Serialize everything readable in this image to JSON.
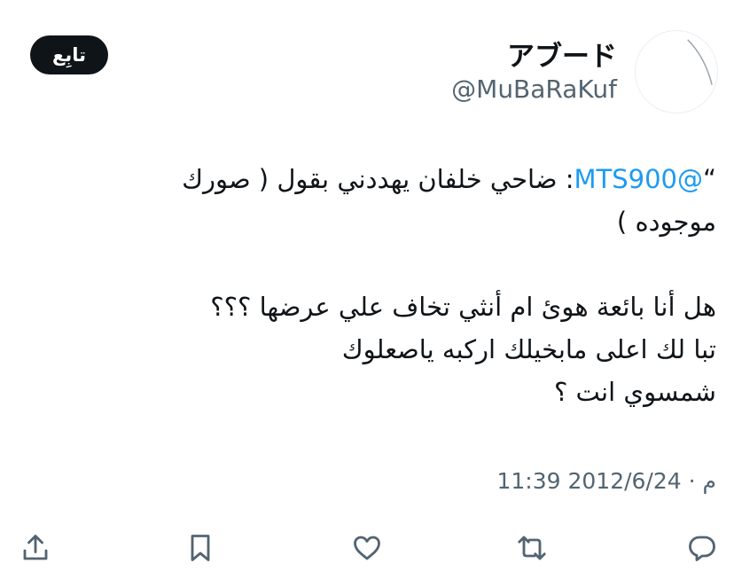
{
  "follow_label": "تابِع",
  "author": {
    "display_name": "アブード",
    "handle": "@MuBaRaKuf",
    "avatar": "blank-avatar"
  },
  "tweet": {
    "quote_open": "“",
    "mention": "@MTS900",
    "line1_rest": ": ضاحي خلفان يهددني بقول ( صورك موجوده )",
    "line2": "هل أنا بائعة هوىٔ ام أنثي تخاف علي عرضها ؟؟؟",
    "line3": "تبا لك اعلى مابخيلك اركبه ياصعلوك",
    "line4": "شمسوي انت ؟",
    "timestamp": "11:39 م · 2012/6/24"
  },
  "colors": {
    "accent": "#1d9bf0",
    "text": "#0f1419",
    "secondary": "#536471",
    "button_bg": "#0f1419"
  },
  "actions": [
    {
      "name": "reply",
      "icon": "reply-icon"
    },
    {
      "name": "retweet",
      "icon": "retweet-icon"
    },
    {
      "name": "like",
      "icon": "heart-icon"
    },
    {
      "name": "bookmark",
      "icon": "bookmark-icon"
    },
    {
      "name": "share",
      "icon": "share-icon"
    }
  ]
}
